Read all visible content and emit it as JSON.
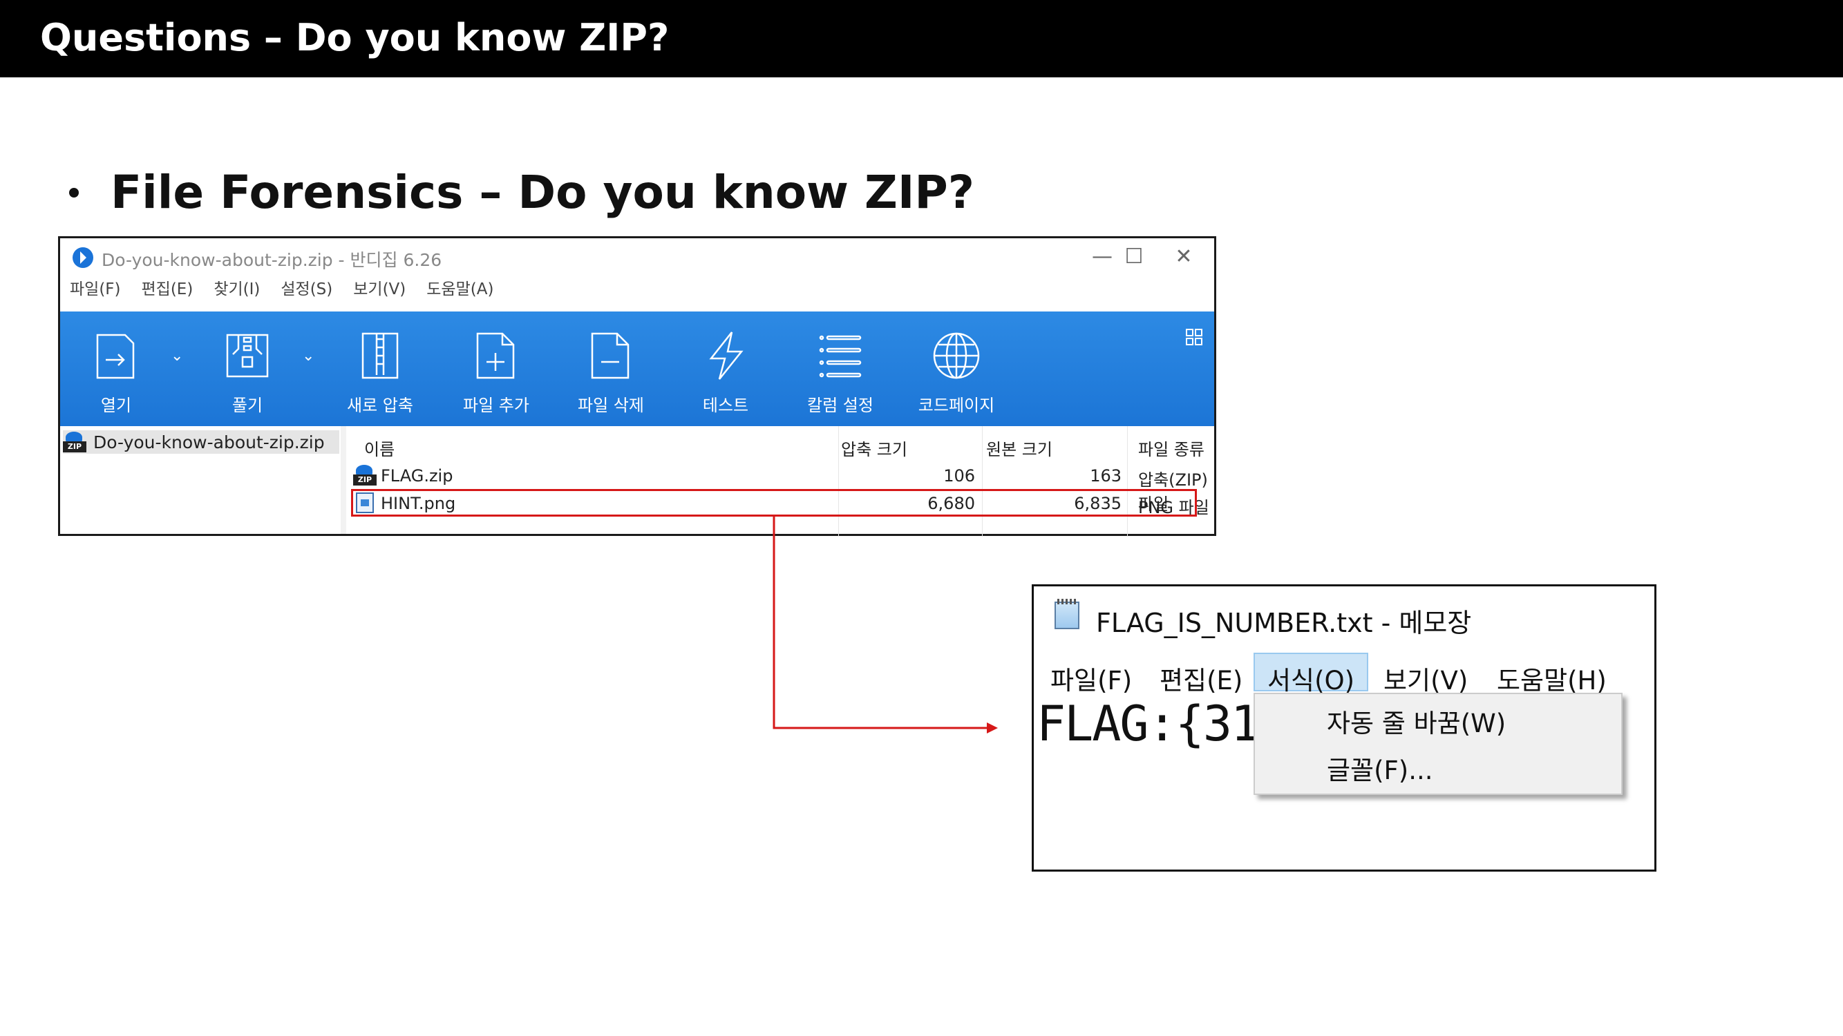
{
  "slide": {
    "title": "Questions – Do you know ZIP?",
    "bullet": "File Forensics – Do you know ZIP?"
  },
  "bandizip": {
    "window_title": "Do-you-know-about-zip.zip - 반디집 6.26",
    "window_buttons": {
      "minimize": "—",
      "maximize": "☐",
      "close": "✕"
    },
    "menu": [
      "파일(F)",
      "편집(E)",
      "찾기(I)",
      "설정(S)",
      "보기(V)",
      "도움말(A)"
    ],
    "toolbar": [
      "열기",
      "풀기",
      "새로 압축",
      "파일 추가",
      "파일 삭제",
      "테스트",
      "칼럼 설정",
      "코드페이지"
    ],
    "toolbar_icons": [
      "open-icon",
      "extract-icon",
      "new-archive-icon",
      "add-file-icon",
      "delete-file-icon",
      "test-icon",
      "columns-icon",
      "codepage-icon"
    ],
    "tree_item": "Do-you-know-about-zip.zip",
    "columns": [
      "이름",
      "압축 크기",
      "원본 크기",
      "파일 종류"
    ],
    "files": [
      {
        "name": "FLAG.zip",
        "packed": "106",
        "original": "163",
        "type": "압축(ZIP) 파일",
        "icon": "zip-file-icon"
      },
      {
        "name": "HINT.png",
        "packed": "6,680",
        "original": "6,835",
        "type": "PNG 파일",
        "icon": "png-file-icon"
      }
    ],
    "ribbon_color": "#2d8ae4",
    "highlight_color": "#d61818"
  },
  "notepad": {
    "title": "FLAG_IS_NUMBER.txt - 메모장",
    "menu": [
      "파일(F)",
      "편집(E)",
      "서식(O)",
      "보기(V)",
      "도움말(H)"
    ],
    "active_menu": "서식(O)",
    "content": "FLAG:{31",
    "dropdown": [
      "자동 줄 바꿈(W)",
      "글꼴(F)..."
    ]
  }
}
